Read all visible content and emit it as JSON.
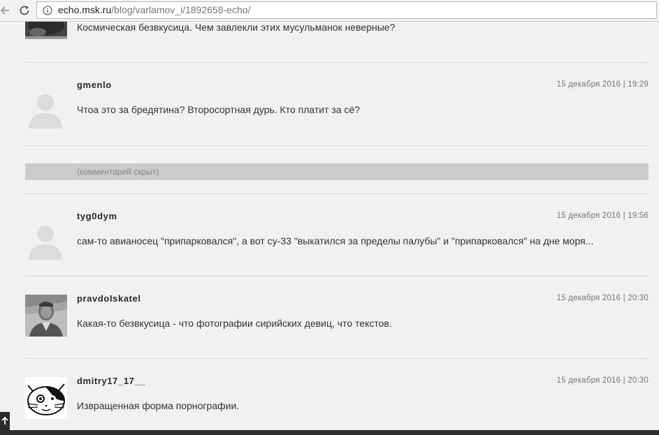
{
  "browser": {
    "url_host": "echo.msk.ru",
    "url_path": "/blog/varlamov_i/1892658-echo/"
  },
  "comments": [
    {
      "text": "Космическая безвкусица. Чем завлекли этих мусульманок неверные?",
      "avatar": "dark-photo-avatar"
    },
    {
      "author": "gmenlo",
      "date": "15 декабря 2016 | 19:29",
      "text": "Чтоа это за бредятина? Второсортная дурь. Кто платит за сё?",
      "avatar": "default-user-avatar"
    },
    {
      "author": "tyg0dym",
      "date": "15 декабря 2016 | 19:56",
      "text": "сам-то авианосец \"припарковался\", а вот су-33 \"выкатился за пределы палубы\" и \"припарковался\" на дне моря...",
      "avatar": "default-user-avatar"
    },
    {
      "author": "pravdoIskatel",
      "date": "15 декабря 2016 | 20:30",
      "text": "Какая-то безвкусица - что фотографии сирийских девиц, что текстов.",
      "avatar": "photo-avatar"
    },
    {
      "author": "dmitry17_17__",
      "date": "15 декабря 2016 | 20:30",
      "text": "Извращенная форма порнографии.",
      "avatar": "cat-drawing-avatar"
    }
  ],
  "hidden_comment": {
    "label": "(комментарий скрыт)"
  },
  "colors": {
    "page_bg": "#f1f1f1",
    "hidden_bar": "#cbcbcb",
    "divider": "#d6d6d6"
  }
}
